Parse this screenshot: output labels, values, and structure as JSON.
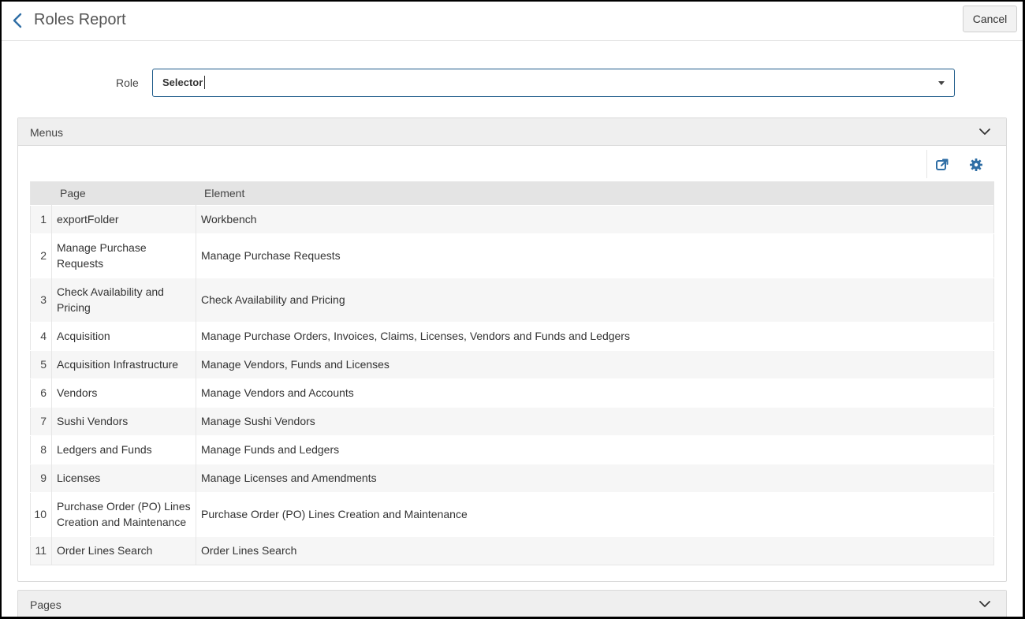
{
  "header": {
    "title": "Roles Report",
    "cancel_label": "Cancel"
  },
  "form": {
    "role_label": "Role",
    "role_value": "Selector"
  },
  "menus": {
    "title": "Menus",
    "columns": [
      "",
      "Page",
      "Element"
    ],
    "rows": [
      {
        "num": "1",
        "page": "exportFolder",
        "element": "Workbench",
        "tall": false
      },
      {
        "num": "2",
        "page": "Manage Purchase Requests",
        "element": "Manage Purchase Requests",
        "tall": true
      },
      {
        "num": "3",
        "page": "Check Availability and Pricing",
        "element": "Check Availability and Pricing",
        "tall": true
      },
      {
        "num": "4",
        "page": "Acquisition",
        "element": "Manage Purchase Orders, Invoices, Claims, Licenses, Vendors and Funds and Ledgers",
        "tall": false
      },
      {
        "num": "5",
        "page": "Acquisition Infrastructure",
        "element": "Manage Vendors, Funds and Licenses",
        "tall": false
      },
      {
        "num": "6",
        "page": "Vendors",
        "element": "Manage Vendors and Accounts",
        "tall": false
      },
      {
        "num": "7",
        "page": "Sushi Vendors",
        "element": "Manage Sushi Vendors",
        "tall": false
      },
      {
        "num": "8",
        "page": "Ledgers and Funds",
        "element": "Manage Funds and Ledgers",
        "tall": false
      },
      {
        "num": "9",
        "page": "Licenses",
        "element": "Manage Licenses and Amendments",
        "tall": false
      },
      {
        "num": "10",
        "page": "Purchase Order (PO) Lines Creation and Maintenance",
        "element": "Purchase Order (PO) Lines Creation and Maintenance",
        "tall": true
      },
      {
        "num": "11",
        "page": "Order Lines Search",
        "element": "Order Lines Search",
        "tall": false
      }
    ]
  },
  "pages_section": {
    "title": "Pages"
  },
  "icons": {
    "back": "chevron-left-icon",
    "export": "external-link-icon",
    "settings": "gear-icon",
    "collapse": "chevron-down-icon"
  },
  "colors": {
    "accent": "#1e5b8a",
    "icon_blue": "#2f6ea5"
  }
}
